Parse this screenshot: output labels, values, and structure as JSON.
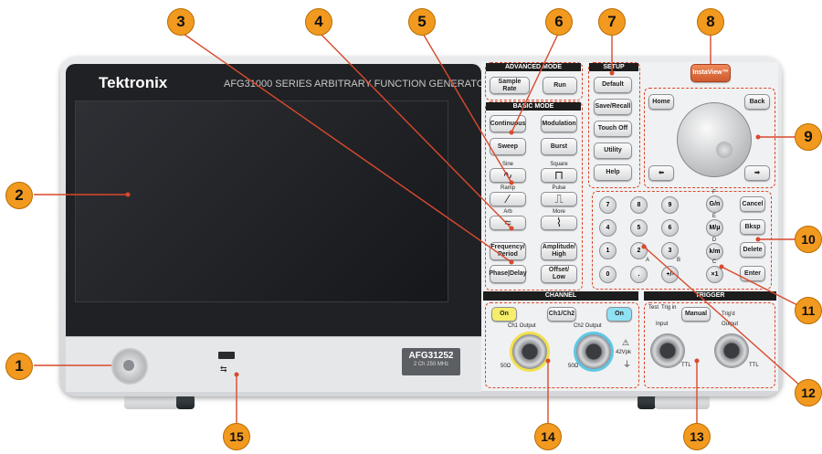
{
  "device": {
    "brand": "Tektronix",
    "series": "AFG31000 SERIES  ARBITRARY FUNCTION GENERATOR",
    "model": "AFG31252",
    "model_sub": "2 Ch    250 MHz"
  },
  "sections": {
    "advanced": {
      "title": "ADVANCED MODE",
      "sample_rate": "Sample Rate",
      "run": "Run"
    },
    "basic": {
      "title": "BASIC MODE",
      "continuous": "Continuous",
      "modulation": "Modulation",
      "sweep": "Sweep",
      "burst": "Burst",
      "sine": "Sine",
      "square": "Square",
      "ramp": "Ramp",
      "pulse": "Pulse",
      "arb": "Arb",
      "more": "More",
      "freq": "Frequency/ Period",
      "amp": "Amplitude/ High",
      "phase": "Phase|Delay",
      "offset": "Offset/ Low"
    },
    "setup": {
      "title": "SETUP",
      "default": "Default",
      "save": "Save/Recall",
      "touch": "Touch Off",
      "utility": "Utility",
      "help": "Help"
    },
    "instaview": "InstaView™",
    "nav": {
      "home": "Home",
      "back": "Back",
      "left": "⬅",
      "right": "➡"
    },
    "keypad": {
      "keys": [
        "7",
        "8",
        "9",
        "4",
        "5",
        "6",
        "1",
        "2",
        "3",
        "0",
        ".",
        "+/-"
      ],
      "unit_g": "G/n",
      "unit_m": "M/μ",
      "unit_k": "k/m",
      "unit_x": "×1",
      "lbl_f": "F",
      "lbl_e": "E",
      "lbl_d": "D",
      "lbl_c": "C",
      "lbl_a": "A",
      "lbl_b": "B",
      "cancel": "Cancel",
      "bksp": "Bksp",
      "delete": "Delete",
      "enter": "Enter"
    },
    "channel": {
      "title": "CHANNEL",
      "on1": "On",
      "ch12": "Ch1/Ch2",
      "on2": "On",
      "out1": "Ch1 Output",
      "out2": "Ch2 Output",
      "ohm1": "50Ω",
      "ohm2": "50Ω",
      "vpk": "42Vpk"
    },
    "trigger": {
      "title": "TRIGGER",
      "test": "Test",
      "trigin": "Trig in",
      "manual": "Manual",
      "trigd": "Trig'd",
      "input": "Input",
      "output": "Output",
      "ttl1": "TTL",
      "ttl2": "TTL"
    }
  },
  "callouts": [
    "1",
    "2",
    "3",
    "4",
    "5",
    "6",
    "7",
    "8",
    "9",
    "10",
    "11",
    "12",
    "13",
    "14",
    "15"
  ],
  "colors": {
    "callout": "#f29a1f",
    "leader": "#d9492c",
    "instaview": "#e0703f",
    "ch1": "#f2e04c",
    "ch2": "#5ec7e6"
  }
}
